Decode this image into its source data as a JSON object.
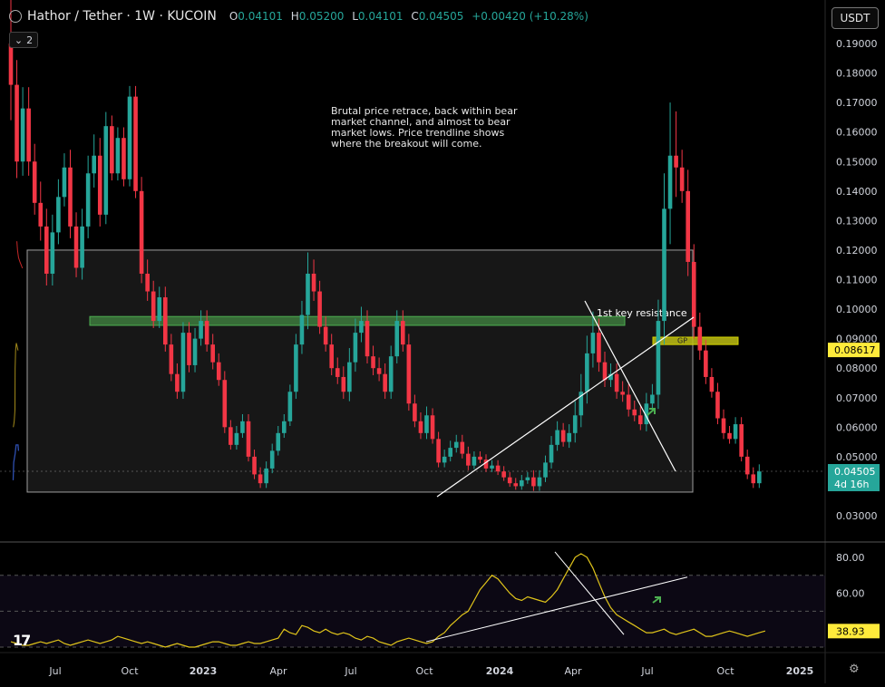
{
  "header": {
    "pair": "Hathor / Tether · 1W · KUCOIN",
    "open_label": "O",
    "open": "0.04101",
    "high_label": "H",
    "high": "0.05200",
    "low_label": "L",
    "low": "0.04101",
    "close_label": "C",
    "close": "0.04505",
    "change": "+0.00420 (+10.28%)",
    "indicators_count": "2",
    "currency": "USDT"
  },
  "colors": {
    "bull": "#26a69a",
    "bear": "#f23645",
    "accent": "#ffeb3b",
    "zone": "#3d7a3d"
  },
  "annotations": {
    "note": "Brutal price retrace, back within bear market channel, and almost to bear market lows. Price trendline shows where the breakout will come.",
    "resistance_label": "1st key resistance",
    "gp_label": "GP"
  },
  "price_axis": {
    "ticks": [
      "0.19000",
      "0.18000",
      "0.17000",
      "0.16000",
      "0.15000",
      "0.14000",
      "0.13000",
      "0.12000",
      "0.11000",
      "0.10000",
      "0.09000",
      "0.08000",
      "0.07000",
      "0.06000",
      "0.05000",
      "0.03000"
    ],
    "current_price": "0.04505",
    "countdown": "4d 16h",
    "marker_price": "0.08617"
  },
  "rsi_axis": {
    "ticks": [
      "80.00",
      "60.00"
    ],
    "value": "38.93"
  },
  "time_axis": {
    "ticks": [
      "Jul",
      "Oct",
      "2023",
      "Apr",
      "Jul",
      "Oct",
      "2024",
      "Apr",
      "Jul",
      "Oct",
      "2025"
    ]
  },
  "chart_data": {
    "type": "candlestick",
    "title": "Hathor / Tether · 1W · KUCOIN",
    "price_range": [
      0.03,
      0.19
    ],
    "x_start": "2022-04",
    "x_end": "2024-07",
    "closes": [
      0.176,
      0.15,
      0.168,
      0.15,
      0.136,
      0.128,
      0.112,
      0.126,
      0.138,
      0.148,
      0.128,
      0.114,
      0.128,
      0.146,
      0.152,
      0.132,
      0.162,
      0.146,
      0.158,
      0.144,
      0.172,
      0.14,
      0.112,
      0.106,
      0.096,
      0.104,
      0.088,
      0.078,
      0.072,
      0.092,
      0.081,
      0.09,
      0.096,
      0.088,
      0.082,
      0.076,
      0.06,
      0.054,
      0.058,
      0.062,
      0.05,
      0.044,
      0.041,
      0.046,
      0.052,
      0.058,
      0.062,
      0.072,
      0.088,
      0.098,
      0.112,
      0.106,
      0.094,
      0.088,
      0.08,
      0.077,
      0.072,
      0.082,
      0.092,
      0.096,
      0.084,
      0.08,
      0.078,
      0.072,
      0.084,
      0.096,
      0.088,
      0.068,
      0.062,
      0.058,
      0.064,
      0.056,
      0.048,
      0.05,
      0.053,
      0.055,
      0.051,
      0.047,
      0.05,
      0.049,
      0.046,
      0.047,
      0.045,
      0.043,
      0.041,
      0.04,
      0.042,
      0.043,
      0.04,
      0.043,
      0.048,
      0.054,
      0.059,
      0.055,
      0.058,
      0.064,
      0.072,
      0.085,
      0.092,
      0.082,
      0.076,
      0.078,
      0.072,
      0.071,
      0.066,
      0.064,
      0.061,
      0.068,
      0.071,
      0.096,
      0.134,
      0.152,
      0.148,
      0.14,
      0.116,
      0.094,
      0.086,
      0.077,
      0.072,
      0.063,
      0.058,
      0.056,
      0.061,
      0.05,
      0.044,
      0.041,
      0.045
    ],
    "volatility": [
      0.03,
      0.014,
      0.012,
      0.012,
      0.01,
      0.012,
      0.01,
      0.01,
      0.01,
      0.008,
      0.01,
      0.008,
      0.01,
      0.01,
      0.012,
      0.01,
      0.008,
      0.006,
      0.006,
      0.006,
      0.006,
      0.006,
      0.008,
      0.008,
      0.006,
      0.006,
      0.006,
      0.006,
      0.006,
      0.006,
      0.006,
      0.006,
      0.006,
      0.006,
      0.006,
      0.005,
      0.005,
      0.004,
      0.004,
      0.004,
      0.004,
      0.004,
      0.004,
      0.004,
      0.004,
      0.004,
      0.004,
      0.004,
      0.006,
      0.008,
      0.012,
      0.008,
      0.006,
      0.006,
      0.006,
      0.006,
      0.006,
      0.008,
      0.008,
      0.008,
      0.006,
      0.006,
      0.006,
      0.006,
      0.006,
      0.006,
      0.006,
      0.006,
      0.005,
      0.005,
      0.005,
      0.004,
      0.004,
      0.004,
      0.004,
      0.004,
      0.004,
      0.004,
      0.003,
      0.003,
      0.003,
      0.003,
      0.003,
      0.003,
      0.003,
      0.003,
      0.003,
      0.003,
      0.004,
      0.004,
      0.004,
      0.005,
      0.005,
      0.004,
      0.005,
      0.008,
      0.01,
      0.01,
      0.012,
      0.008,
      0.006,
      0.006,
      0.006,
      0.006,
      0.006,
      0.005,
      0.005,
      0.006,
      0.006,
      0.012,
      0.02,
      0.03,
      0.025,
      0.01,
      0.012,
      0.01,
      0.008,
      0.006,
      0.005,
      0.005,
      0.005,
      0.004,
      0.004,
      0.004,
      0.004,
      0.004,
      0.004
    ],
    "zones": [
      {
        "name": "bear market channel",
        "top": 0.12,
        "bottom": 0.038
      },
      {
        "name": "1st key resistance",
        "top": 0.0975,
        "bottom": 0.0945
      },
      {
        "name": "GP",
        "top": 0.0905,
        "bottom": 0.088
      }
    ],
    "moving_averages": {
      "red": [
        [
          0.125,
          0.123
        ],
        [
          0.14,
          0.12
        ],
        [
          0.16,
          0.1175
        ],
        [
          0.19,
          0.116
        ],
        [
          0.215,
          0.115
        ],
        [
          0.24,
          0.114
        ],
        [
          0.25,
          0.114
        ]
      ],
      "orange": [
        [
          0.052,
          0.06
        ],
        [
          0.07,
          0.062
        ],
        [
          0.085,
          0.066
        ],
        [
          0.09,
          0.08
        ],
        [
          0.1,
          0.086
        ],
        [
          0.115,
          0.0885
        ],
        [
          0.13,
          0.0875
        ],
        [
          0.15,
          0.086
        ]
      ],
      "blue": [
        [
          0.048,
          0.042
        ],
        [
          0.06,
          0.048
        ],
        [
          0.09,
          0.051
        ],
        [
          0.11,
          0.054
        ],
        [
          0.13,
          0.054
        ],
        [
          0.15,
          0.054
        ],
        [
          0.16,
          0.052
        ]
      ]
    },
    "rsi": {
      "range": [
        30,
        85
      ],
      "levels": [
        70,
        50,
        30
      ],
      "value": 38.93,
      "values": [
        33,
        32,
        31,
        31,
        32,
        33,
        32,
        33,
        34,
        32,
        31,
        32,
        33,
        34,
        33,
        32,
        33,
        34,
        36,
        35,
        34,
        33,
        32,
        33,
        32,
        31,
        30,
        31,
        32,
        31,
        30,
        30,
        31,
        32,
        33,
        33,
        32,
        31,
        31,
        32,
        33,
        32,
        32,
        33,
        34,
        35,
        40,
        38,
        37,
        42,
        41,
        39,
        38,
        40,
        38,
        37,
        38,
        37,
        35,
        34,
        36,
        35,
        33,
        32,
        31,
        33,
        34,
        35,
        34,
        33,
        32,
        33,
        36,
        38,
        42,
        45,
        48,
        50,
        56,
        62,
        66,
        70,
        68,
        64,
        60,
        57,
        56,
        58,
        57,
        56,
        55,
        58,
        62,
        68,
        74,
        80,
        82,
        80,
        74,
        66,
        58,
        52,
        48,
        46,
        44,
        42,
        40,
        38,
        38,
        39,
        40,
        38,
        37,
        38,
        39,
        40,
        38,
        36,
        36,
        37,
        38,
        39,
        38,
        37,
        36,
        37,
        38,
        39
      ]
    }
  }
}
